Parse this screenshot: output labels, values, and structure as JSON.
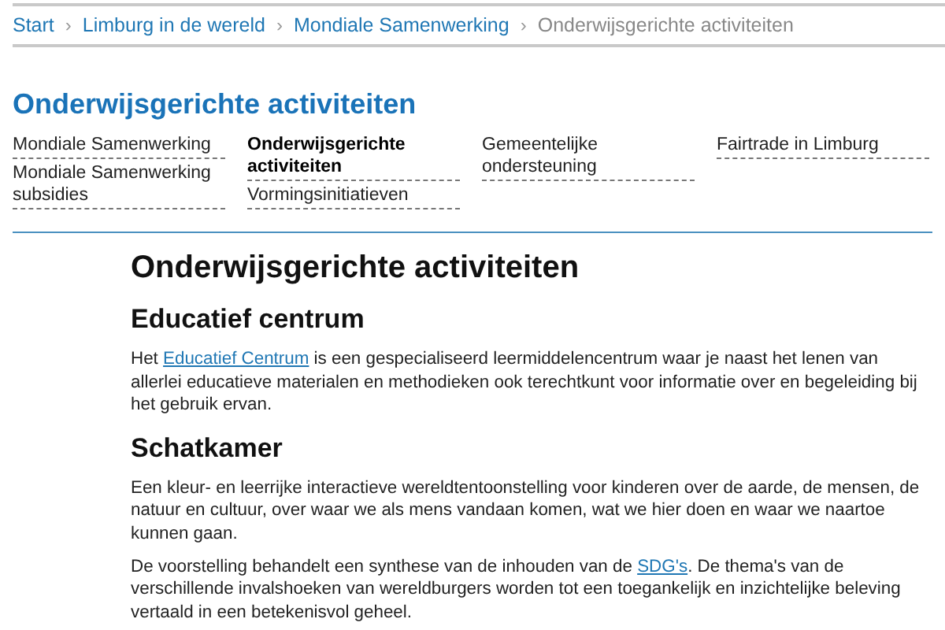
{
  "breadcrumb": [
    {
      "label": "Start",
      "current": false
    },
    {
      "label": "Limburg in de wereld",
      "current": false
    },
    {
      "label": "Mondiale Samenwerking",
      "current": false
    },
    {
      "label": "Onderwijsgerichte activiteiten",
      "current": true
    }
  ],
  "breadcrumb_separator": "›",
  "section_title": "Onderwijsgerichte activiteiten",
  "subnav": [
    [
      {
        "label": "Mondiale Samenwerking",
        "selected": false
      },
      {
        "label": "Mondiale Samenwerking subsidies",
        "selected": false
      }
    ],
    [
      {
        "label": "Onderwijsgerichte activiteiten",
        "selected": true
      },
      {
        "label": "Vormingsinitiatieven",
        "selected": false
      }
    ],
    [
      {
        "label": "Gemeentelijke ondersteuning",
        "selected": false
      }
    ],
    [
      {
        "label": "Fairtrade in Limburg",
        "selected": false
      }
    ]
  ],
  "article": {
    "title": "Onderwijsgerichte activiteiten",
    "sections": [
      {
        "heading": "Educatief centrum",
        "paragraphs": [
          [
            {
              "kind": "text",
              "text": "Het "
            },
            {
              "kind": "link",
              "text": "Educatief Centrum"
            },
            {
              "kind": "text",
              "text": " is een gespecialiseerd leermiddelencentrum waar je naast het lenen van allerlei educatieve materialen en methodieken ook terechtkunt voor informatie over en begeleiding bij het gebruik ervan."
            }
          ]
        ]
      },
      {
        "heading": "Schatkamer",
        "paragraphs": [
          [
            {
              "kind": "text",
              "text": "Een kleur- en leerrijke interactieve wereldtentoonstelling voor kinderen over de aarde, de mensen, de natuur en cultuur, over waar we als mens vandaan komen, wat we hier doen en waar we naartoe kunnen gaan."
            }
          ],
          [
            {
              "kind": "text",
              "text": "De voorstelling behandelt een synthese van de inhouden van de "
            },
            {
              "kind": "link",
              "text": "SDG's"
            },
            {
              "kind": "text",
              "text": ". De thema's van de verschillende invalshoeken van wereldburgers worden tot een toegankelijk en inzichtelijke beleving vertaald in een betekenisvol geheel."
            }
          ]
        ]
      }
    ]
  }
}
